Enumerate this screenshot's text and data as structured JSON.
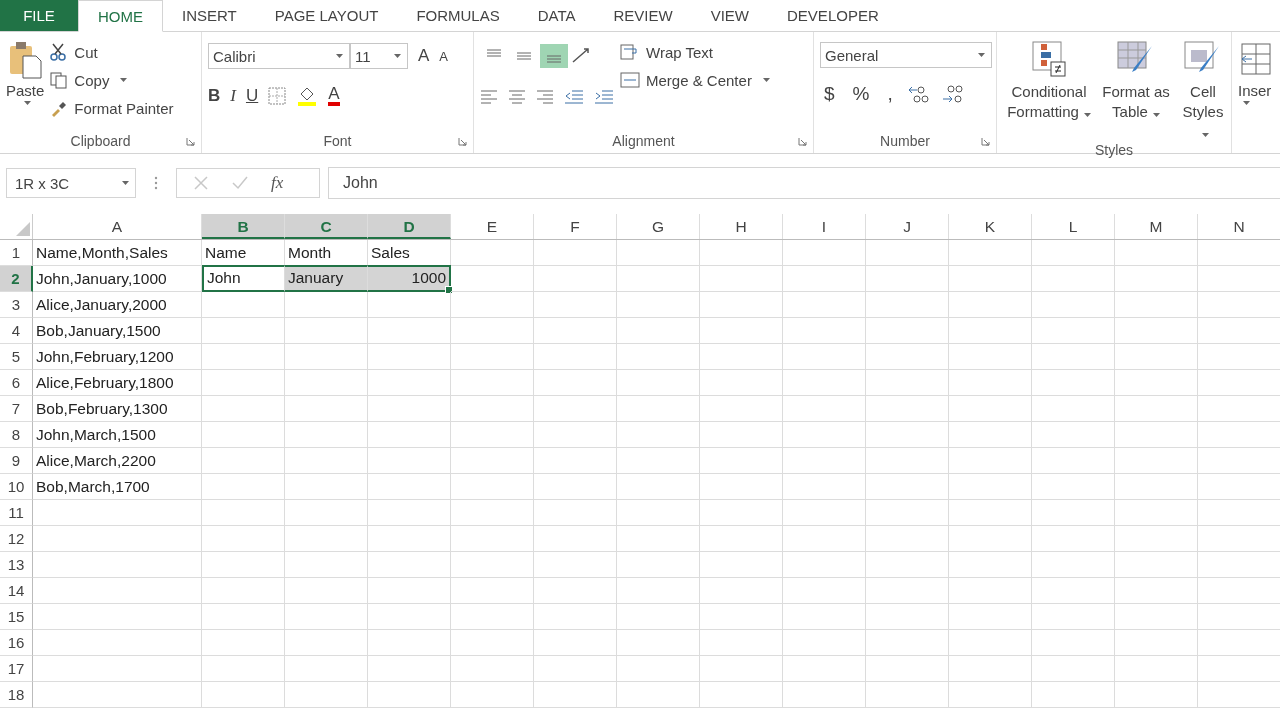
{
  "tabs": [
    {
      "label": "FILE",
      "kind": "file",
      "selected": false
    },
    {
      "label": "HOME",
      "kind": "tab",
      "selected": true
    },
    {
      "label": "INSERT",
      "kind": "tab",
      "selected": false
    },
    {
      "label": "PAGE LAYOUT",
      "kind": "tab",
      "selected": false
    },
    {
      "label": "FORMULAS",
      "kind": "tab",
      "selected": false
    },
    {
      "label": "DATA",
      "kind": "tab",
      "selected": false
    },
    {
      "label": "REVIEW",
      "kind": "tab",
      "selected": false
    },
    {
      "label": "VIEW",
      "kind": "tab",
      "selected": false
    },
    {
      "label": "DEVELOPER",
      "kind": "tab",
      "selected": false
    }
  ],
  "ribbon": {
    "clipboard": {
      "label": "Clipboard",
      "paste": "Paste",
      "cut": "Cut",
      "copy": "Copy",
      "format_painter": "Format Painter"
    },
    "font": {
      "label": "Font",
      "font_name": "Calibri",
      "font_size": "11",
      "grow": "A",
      "shrink": "A",
      "bold": "B",
      "italic": "I",
      "underline": "U",
      "font_color": "A"
    },
    "alignment": {
      "label": "Alignment",
      "wrap_text": "Wrap Text",
      "merge_center": "Merge & Center",
      "vertical": [
        {
          "selected": false
        },
        {
          "selected": false
        },
        {
          "selected": true
        }
      ]
    },
    "number": {
      "label": "Number",
      "format": "General",
      "currency": "$",
      "percent": "%",
      "comma": ","
    },
    "styles": {
      "label": "Styles",
      "conditional_formatting": "Conditional Formatting",
      "format_as_table": "Format as Table",
      "cell_styles": "Cell Styles"
    },
    "cells": {
      "insert": "Inser"
    }
  },
  "formula_bar": {
    "name_box": "1R x 3C",
    "fx": "fx",
    "value": "John"
  },
  "grid": {
    "columns": [
      {
        "label": "A",
        "selected": false
      },
      {
        "label": "B",
        "selected": true
      },
      {
        "label": "C",
        "selected": true
      },
      {
        "label": "D",
        "selected": true
      },
      {
        "label": "E",
        "selected": false
      },
      {
        "label": "F",
        "selected": false
      },
      {
        "label": "G",
        "selected": false
      },
      {
        "label": "H",
        "selected": false
      },
      {
        "label": "I",
        "selected": false
      },
      {
        "label": "J",
        "selected": false
      },
      {
        "label": "K",
        "selected": false
      },
      {
        "label": "L",
        "selected": false
      },
      {
        "label": "M",
        "selected": false
      },
      {
        "label": "N",
        "selected": false
      }
    ],
    "rows": [
      {
        "header": "1",
        "selected": false,
        "cells": [
          {
            "text": "Name,Month,Sales",
            "kind": "text",
            "selected": false,
            "active": false
          },
          {
            "text": "Name",
            "kind": "text",
            "selected": false,
            "active": false
          },
          {
            "text": "Month",
            "kind": "text",
            "selected": false,
            "active": false
          },
          {
            "text": "Sales",
            "kind": "text",
            "selected": false,
            "active": false
          }
        ]
      },
      {
        "header": "2",
        "selected": true,
        "cells": [
          {
            "text": "John,January,1000",
            "kind": "text",
            "selected": false,
            "active": false
          },
          {
            "text": "John",
            "kind": "text",
            "selected": true,
            "active": true
          },
          {
            "text": "January",
            "kind": "text",
            "selected": true,
            "active": false
          },
          {
            "text": "1000",
            "kind": "number",
            "selected": true,
            "active": false
          }
        ]
      },
      {
        "header": "3",
        "selected": false,
        "cells": [
          {
            "text": "Alice,January,2000",
            "kind": "text",
            "selected": false,
            "active": false
          }
        ]
      },
      {
        "header": "4",
        "selected": false,
        "cells": [
          {
            "text": "Bob,January,1500",
            "kind": "text",
            "selected": false,
            "active": false
          }
        ]
      },
      {
        "header": "5",
        "selected": false,
        "cells": [
          {
            "text": "John,February,1200",
            "kind": "text",
            "selected": false,
            "active": false
          }
        ]
      },
      {
        "header": "6",
        "selected": false,
        "cells": [
          {
            "text": "Alice,February,1800",
            "kind": "text",
            "selected": false,
            "active": false
          }
        ]
      },
      {
        "header": "7",
        "selected": false,
        "cells": [
          {
            "text": "Bob,February,1300",
            "kind": "text",
            "selected": false,
            "active": false
          }
        ]
      },
      {
        "header": "8",
        "selected": false,
        "cells": [
          {
            "text": "John,March,1500",
            "kind": "text",
            "selected": false,
            "active": false
          }
        ]
      },
      {
        "header": "9",
        "selected": false,
        "cells": [
          {
            "text": "Alice,March,2200",
            "kind": "text",
            "selected": false,
            "active": false
          }
        ]
      },
      {
        "header": "10",
        "selected": false,
        "cells": [
          {
            "text": "Bob,March,1700",
            "kind": "text",
            "selected": false,
            "active": false
          }
        ]
      },
      {
        "header": "11",
        "selected": false
      },
      {
        "header": "12",
        "selected": false
      },
      {
        "header": "13",
        "selected": false
      },
      {
        "header": "14",
        "selected": false
      },
      {
        "header": "15",
        "selected": false
      },
      {
        "header": "16",
        "selected": false
      },
      {
        "header": "17",
        "selected": false
      },
      {
        "header": "18",
        "selected": false
      }
    ]
  }
}
